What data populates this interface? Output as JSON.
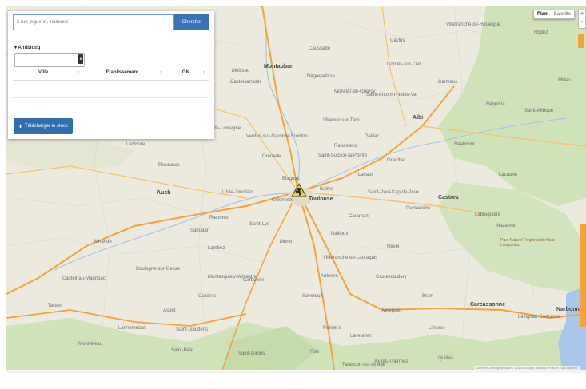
{
  "search": {
    "placeholder": "2 rue Viguerie, Toulouse",
    "button_label": "Chercher"
  },
  "panel": {
    "section_title": "Antibiotiq",
    "select_value": "",
    "table_headers": [
      "Ville",
      "Etablissement",
      "GN"
    ],
    "download_label": "Télécharger le stock"
  },
  "map": {
    "type_buttons": [
      "Plan",
      "Satellite"
    ],
    "zoom_plus": "+",
    "zoom_minus": "-",
    "city": "Toulouse",
    "places": [
      "Montauban",
      "Castelsarrasin",
      "Moissac",
      "Grenade",
      "Castres",
      "Albi",
      "Gaillac",
      "Lavaur",
      "Saint-Sulpice-la-Pointe",
      "Graulhet",
      "Muret",
      "Colomiers",
      "Blagnac",
      "Balma",
      "Saint-Lys",
      "Auterive",
      "Villefranche-de-Lauragais",
      "Castelnaudary",
      "Revel",
      "Pamiers",
      "Foix",
      "Saint-Gaudens",
      "Carbonne",
      "Lannemezan",
      "Tarbes",
      "Mirande",
      "Auch",
      "L'Isle-Jourdain",
      "Samatan",
      "Lombez",
      "Fleurance",
      "Lectoure",
      "Beaumont-de-Lomagne",
      "Verdun-sur-Garonne",
      "Fronton",
      "Villemur-sur-Tarn",
      "Caussade",
      "Nègrepelisse",
      "Cordes-sur-Ciel",
      "Carmaux",
      "Réalmont",
      "Mazamet",
      "Labruguière",
      "Saint-Paul-Cap-de-Joux",
      "Puylaurens",
      "Caraman",
      "Nailloux",
      "Saverdun",
      "Mirepoix",
      "Lavelanet",
      "Limoux",
      "Carcassonne",
      "Bram",
      "Lézignan-Corbières",
      "Narbonne",
      "Quillan",
      "Saint-Girons",
      "Montréjeau",
      "Boulogne-sur-Gesse",
      "Castelnau-Magnoac",
      "Rodez",
      "Saint-Affrique",
      "Millau",
      "Réquista",
      "Lacaune",
      "Villefranche-de-Rouergue",
      "Caylus",
      "Saint-Antonin-Noble-Val",
      "Monclar-de-Quercy",
      "Rabastens",
      "Parc Naturel Régional du Haut-Languedoc",
      "Plan",
      "Montesquieu-Volvestre",
      "Cazères",
      "Rieumes",
      "Aspet",
      "Saint-Béat",
      "Ax-les-Thermes",
      "Tarascon-sur-Ariège"
    ],
    "footer": "Données cartographiques ©2015 Google, basado en BCN IGN España"
  }
}
